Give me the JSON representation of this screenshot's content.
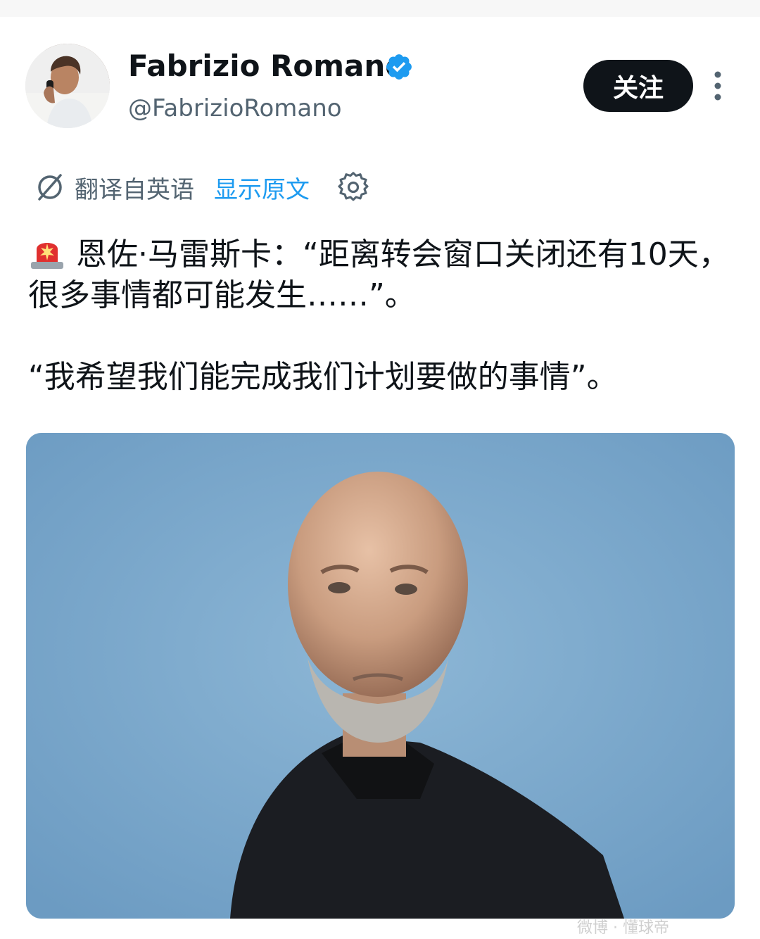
{
  "author": {
    "display_name": "Fabrizio Romano",
    "handle": "@FabrizioRomano",
    "verified": true,
    "verified_color": "#1d9bf0"
  },
  "actions": {
    "follow_label": "关注",
    "more_icon": "more-vertical-icon"
  },
  "translation": {
    "notice": "翻译自英语",
    "show_original": "显示原文",
    "icon": "translate-icon",
    "settings_icon": "gear-icon"
  },
  "tweet": {
    "emoji": "police-light-emoji",
    "line1": "恩佐·马雷斯卡：“距离转会窗口关闭还有10天，很多事情都可能发生……”。",
    "line2": "“我希望我们能完成我们计划要做的事情”。"
  },
  "media": {
    "alt": "photo",
    "background_color": "#7aa8cc"
  },
  "colors": {
    "text": "#0f1419",
    "secondary": "#536471",
    "accent": "#1d9bf0",
    "button": "#0f1419"
  }
}
